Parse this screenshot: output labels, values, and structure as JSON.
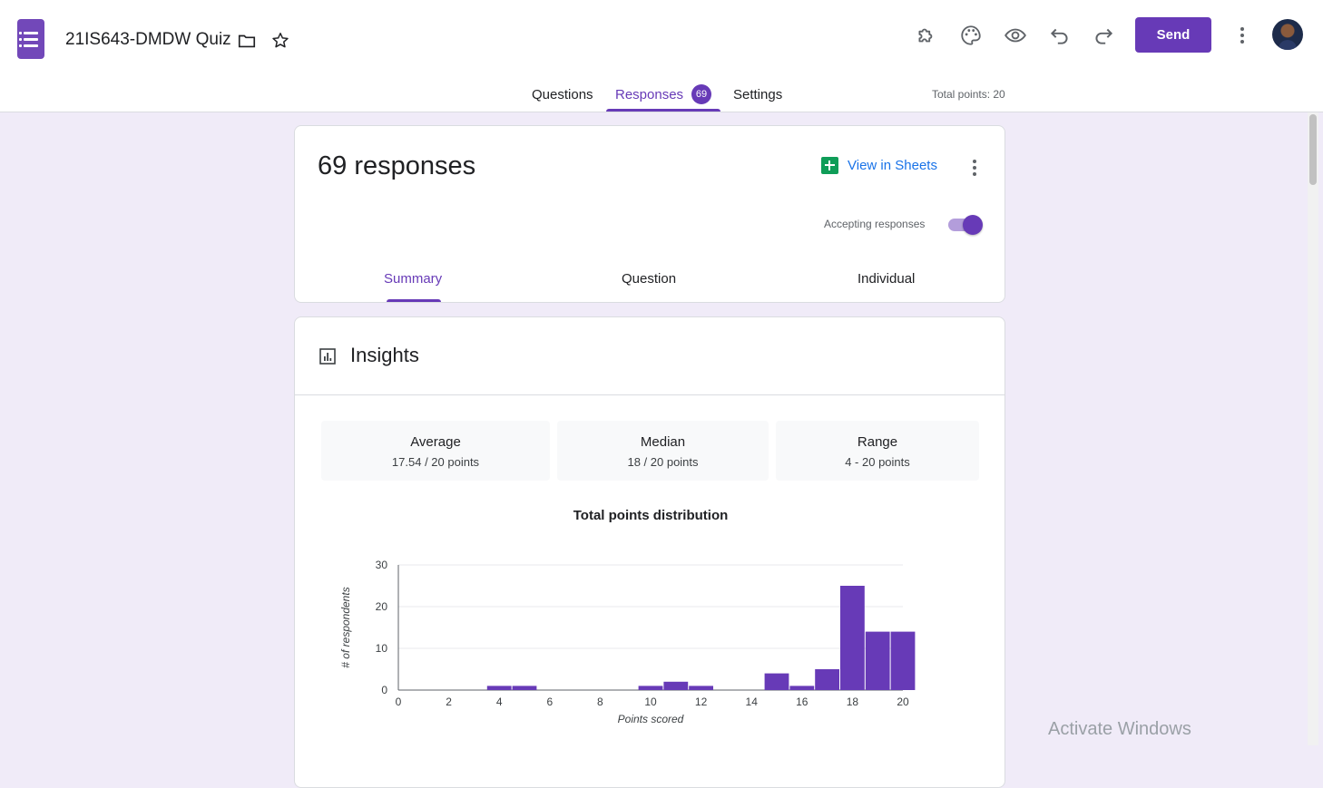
{
  "header": {
    "doc_title": "21IS643-DMDW Quiz",
    "send_label": "Send",
    "tabs": [
      {
        "label": "Questions"
      },
      {
        "label": "Responses",
        "badge": "69"
      },
      {
        "label": "Settings"
      }
    ],
    "total_points": "Total points: 20"
  },
  "summary": {
    "count_text": "69 responses",
    "view_in_sheets": "View in Sheets",
    "accepting_label": "Accepting responses",
    "accepting_on": true,
    "tabs": [
      "Summary",
      "Question",
      "Individual"
    ]
  },
  "insights": {
    "title": "Insights",
    "stats": [
      {
        "label": "Average",
        "value": "17.54 / 20 points"
      },
      {
        "label": "Median",
        "value": "18 / 20 points"
      },
      {
        "label": "Range",
        "value": "4 - 20 points"
      }
    ]
  },
  "chart_data": {
    "type": "bar",
    "title": "Total points distribution",
    "xlabel": "Points scored",
    "ylabel": "# of respondents",
    "x": [
      4,
      5,
      10,
      11,
      12,
      15,
      16,
      17,
      18,
      19,
      20
    ],
    "values": [
      1,
      1,
      1,
      2,
      1,
      4,
      1,
      5,
      25,
      14,
      14
    ],
    "xlim": [
      0,
      20
    ],
    "ylim": [
      0,
      30
    ],
    "xticks": [
      0,
      2,
      4,
      6,
      8,
      10,
      12,
      14,
      16,
      18,
      20
    ],
    "yticks": [
      0,
      10,
      20,
      30
    ],
    "grid": true,
    "bar_color": "#673ab7"
  },
  "overlay": {
    "activate_windows": "Activate Windows"
  },
  "colors": {
    "accent": "#673ab7",
    "background": "#f0ebf8",
    "link": "#1a73e8",
    "sheets": "#0f9d58"
  }
}
